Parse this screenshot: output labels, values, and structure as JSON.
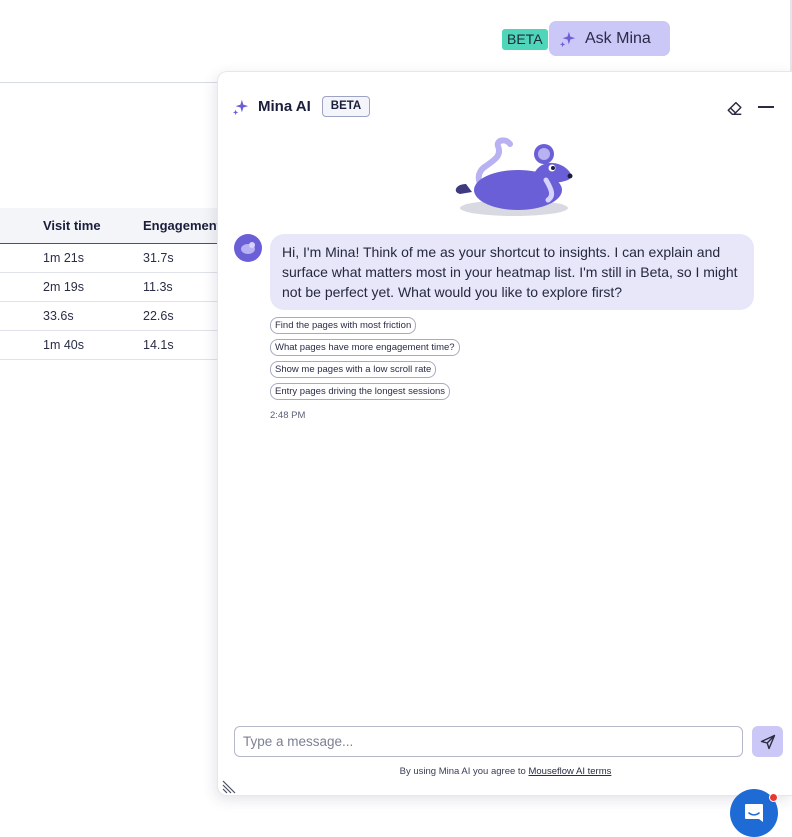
{
  "topbar": {
    "beta_label": "BETA",
    "ask_label": "Ask Mina"
  },
  "table": {
    "headers": [
      "Visit time",
      "Engagement"
    ],
    "rows": [
      [
        "1m 21s",
        "31.7s"
      ],
      [
        "2m 19s",
        "11.3s"
      ],
      [
        "33.6s",
        "22.6s"
      ],
      [
        "1m 40s",
        "14.1s"
      ]
    ]
  },
  "chat": {
    "title": "Mina AI",
    "beta_label": "BETA",
    "message": "Hi, I'm Mina! Think of me as your shortcut to insights. I can explain and surface what matters most in your heatmap list. I'm still in Beta, so I might not be perfect yet. What would you like to explore first?",
    "suggestions": [
      "Find the pages with most friction",
      "What pages have more engagement time?",
      "Show me pages with a low scroll rate",
      "Entry pages driving the longest sessions"
    ],
    "timestamp": "2:48 PM",
    "input_placeholder": "Type a message...",
    "terms_prefix": "By using Mina AI you agree to ",
    "terms_link": "Mouseflow AI terms"
  },
  "colors": {
    "accent": "#cbc7f7",
    "beta_green": "#4fd6b8",
    "mascot": "#6a5fd6",
    "help_button": "#1f6bd6"
  }
}
